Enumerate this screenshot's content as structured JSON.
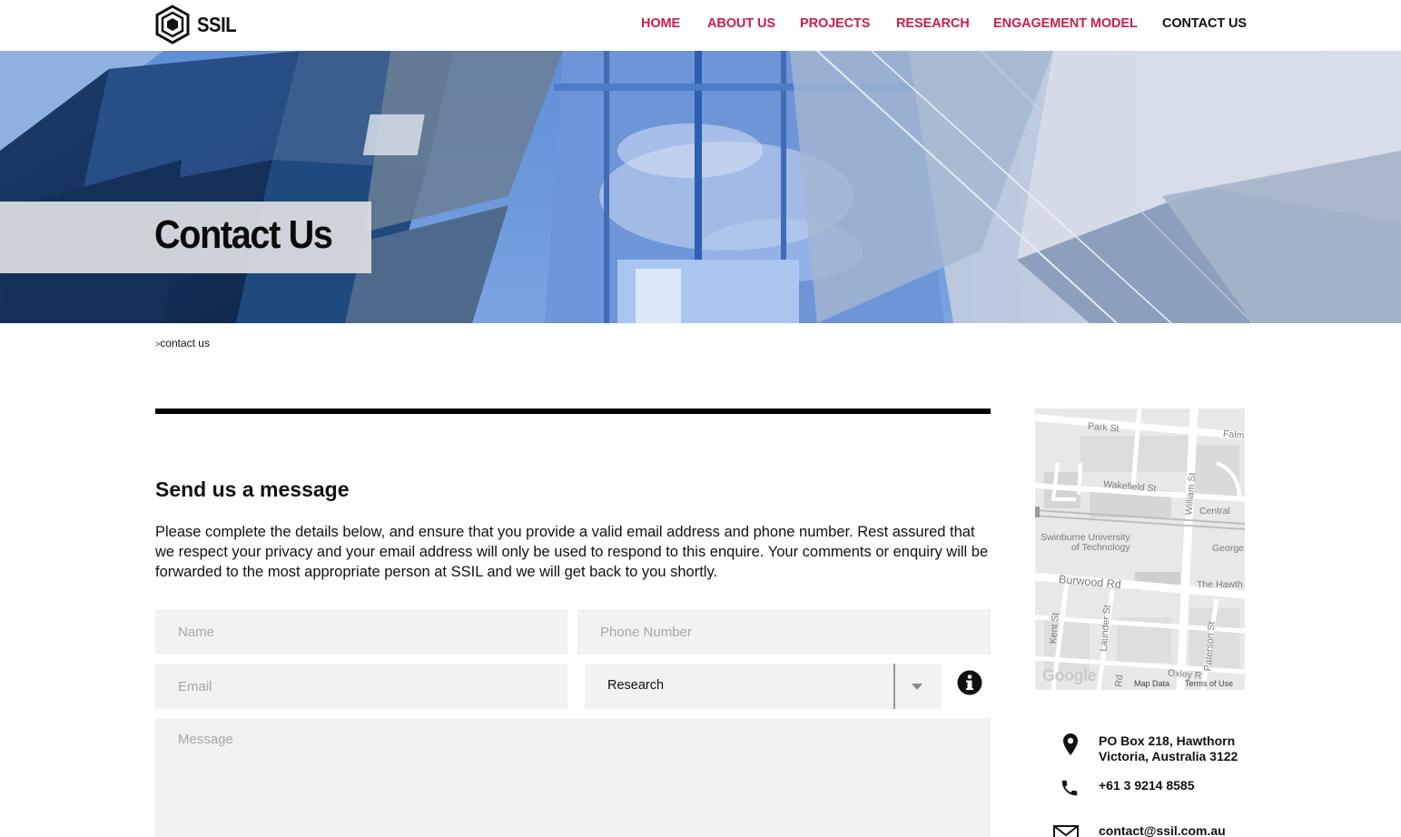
{
  "brand": {
    "name": "SSIL",
    "accent_color": "#cc1e45"
  },
  "nav": {
    "items": [
      {
        "label": "HOME",
        "active": false
      },
      {
        "label": "ABOUT US",
        "active": false
      },
      {
        "label": "PROJECTS",
        "active": false
      },
      {
        "label": "RESEARCH",
        "active": false
      },
      {
        "label": "ENGAGEMENT MODEL",
        "active": false
      },
      {
        "label": "CONTACT US",
        "active": true
      }
    ]
  },
  "hero": {
    "title": "Contact Us"
  },
  "breadcrumb": {
    "separator": ">",
    "current": "contact us"
  },
  "form": {
    "title": "Send us a message",
    "intro": "Please complete the details below, and ensure that you provide a valid email address and phone number. Rest assured that we respect your privacy and your email address will only be used to respond to this enquire. Your comments or enquiry will be forwarded to the most appropriate person at SSIL and we will get back to you shortly.",
    "name_placeholder": "Name",
    "phone_placeholder": "Phone Number",
    "email_placeholder": "Email",
    "category_selected": "Research",
    "message_placeholder": "Message"
  },
  "map": {
    "labels": {
      "park": "Park St",
      "falm": "Falm",
      "wakefield": "Wakefield St",
      "william": "William St",
      "central": "Central",
      "swinburne1": "Swinburne University",
      "swinburne2": "of Technology",
      "george": "George",
      "burwood": "Burwood Rd",
      "hawth": "The Hawth",
      "kent": "Kent St",
      "launder": "Launder St",
      "paterson": "Paterson St",
      "oxley": "Oxley R",
      "rd": "Rd"
    },
    "google": "Google",
    "map_data": "Map Data",
    "terms": "Terms of Use"
  },
  "contact": {
    "address_line1": "PO Box 218, Hawthorn",
    "address_line2": "Victoria, Australia 3122",
    "phone": "+61 3 9214 8585",
    "email": "contact@ssil.com.au"
  }
}
